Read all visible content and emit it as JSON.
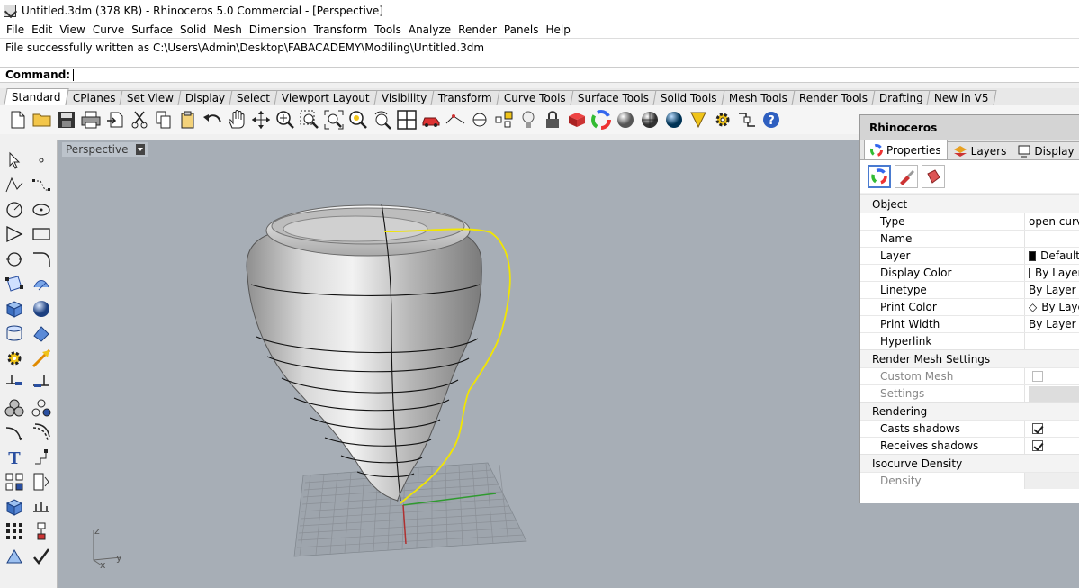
{
  "window": {
    "title": "Untitled.3dm (378 KB) - Rhinoceros 5.0 Commercial - [Perspective]"
  },
  "menu": [
    "File",
    "Edit",
    "View",
    "Curve",
    "Surface",
    "Solid",
    "Mesh",
    "Dimension",
    "Transform",
    "Tools",
    "Analyze",
    "Render",
    "Panels",
    "Help"
  ],
  "history": {
    "message": "File successfully written as C:\\Users\\Admin\\Desktop\\FABACADEMY\\Modiling\\Untitled.3dm"
  },
  "command": {
    "label": "Command:",
    "value": ""
  },
  "toolbar_tabs": [
    {
      "label": "Standard",
      "active": true
    },
    {
      "label": "CPlanes"
    },
    {
      "label": "Set View"
    },
    {
      "label": "Display"
    },
    {
      "label": "Select"
    },
    {
      "label": "Viewport Layout"
    },
    {
      "label": "Visibility"
    },
    {
      "label": "Transform"
    },
    {
      "label": "Curve Tools"
    },
    {
      "label": "Surface Tools"
    },
    {
      "label": "Solid Tools"
    },
    {
      "label": "Mesh Tools"
    },
    {
      "label": "Render Tools"
    },
    {
      "label": "Drafting"
    },
    {
      "label": "New in V5"
    }
  ],
  "toolbar_icons": [
    "new-file",
    "open-folder",
    "save",
    "print",
    "import",
    "cut",
    "copy",
    "paste",
    "undo",
    "pan-hand",
    "rotate-view",
    "zoom-dynamic",
    "zoom-window",
    "zoom-extents",
    "zoom-selected",
    "rotate-camera",
    "four-viewports",
    "car-named-view",
    "camera-target",
    "circle-cplane",
    "select-points",
    "lightbulb",
    "lock",
    "render-shaded",
    "color-wheel",
    "sphere-shaded",
    "sphere-render",
    "sphere-blue",
    "light-cone",
    "options-gear",
    "grip-tool",
    "help"
  ],
  "sidebar_icons": [
    "select-arrow",
    "point",
    "polyline",
    "curve-cp",
    "circle",
    "ellipse",
    "polygon",
    "rectangle",
    "arc",
    "fillet-curve",
    "surface-cp",
    "loft",
    "box",
    "sphere",
    "extrude",
    "patch",
    "transform-gear",
    "boolean-arrow",
    "trim",
    "split",
    "group",
    "explode",
    "offset",
    "blend",
    "text",
    "dimension",
    "array",
    "arrange",
    "solid-cube",
    "distribute",
    "grid-array",
    "flow",
    "mirror",
    "check"
  ],
  "viewport": {
    "title": "Perspective",
    "axis_x": "x",
    "axis_y": "y",
    "axis_z": "z"
  },
  "panel": {
    "title": "Rhinoceros",
    "tabs": [
      {
        "label": "Properties",
        "active": true
      },
      {
        "label": "Layers"
      },
      {
        "label": "Display"
      }
    ],
    "sections": {
      "object": "Object",
      "render_mesh": "Render Mesh Settings",
      "rendering": "Rendering",
      "isocurve": "Isocurve Density"
    },
    "object": [
      {
        "key": "Type",
        "value": "open curve"
      },
      {
        "key": "Name",
        "value": ""
      },
      {
        "key": "Layer",
        "value": "Default"
      },
      {
        "key": "Display Color",
        "value": "By Layer"
      },
      {
        "key": "Linetype",
        "value": "By Layer"
      },
      {
        "key": "Print Color",
        "value": "By Layer"
      },
      {
        "key": "Print Width",
        "value": "By Layer"
      },
      {
        "key": "Hyperlink",
        "value": ""
      }
    ],
    "render_mesh": {
      "custom_mesh": "Custom Mesh",
      "settings": "Settings"
    },
    "rendering": {
      "casts": "Casts shadows",
      "receives": "Receives shadows"
    },
    "isocurve": {
      "density": "Density"
    }
  }
}
